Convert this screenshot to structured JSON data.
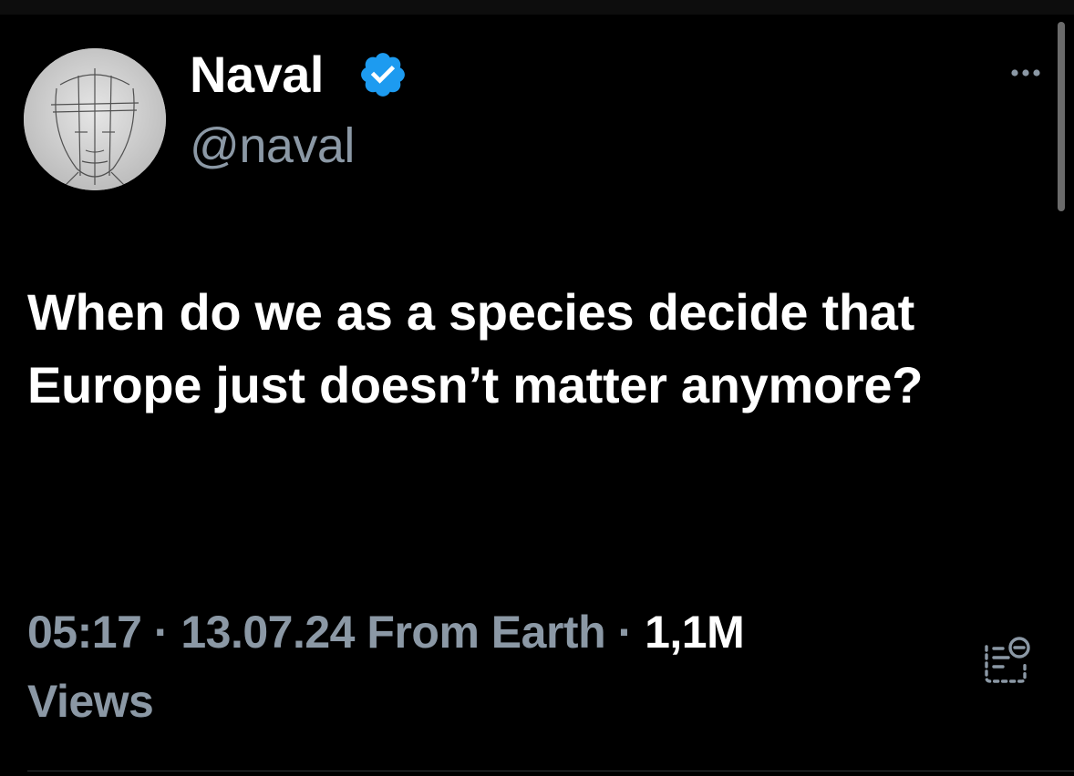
{
  "user": {
    "display_name": "Naval",
    "handle": "@naval",
    "verified": true,
    "verified_icon": "verified-badge-icon",
    "verified_color": "#1d9bf0"
  },
  "tweet": {
    "text": "When do we as a species decide that Europe just doesn’t matter anymore?"
  },
  "meta": {
    "time": "05:17",
    "separator": "·",
    "date": "13.07.24",
    "source": "From Earth",
    "views_count": "1,1M",
    "views_label": "Views"
  },
  "actions": {
    "more_icon": "more-horizontal-icon",
    "stats_icon": "post-analytics-icon"
  },
  "colors": {
    "background": "#000000",
    "primary_text": "#ffffff",
    "secondary_text": "#8b98a5",
    "accent": "#1d9bf0"
  }
}
